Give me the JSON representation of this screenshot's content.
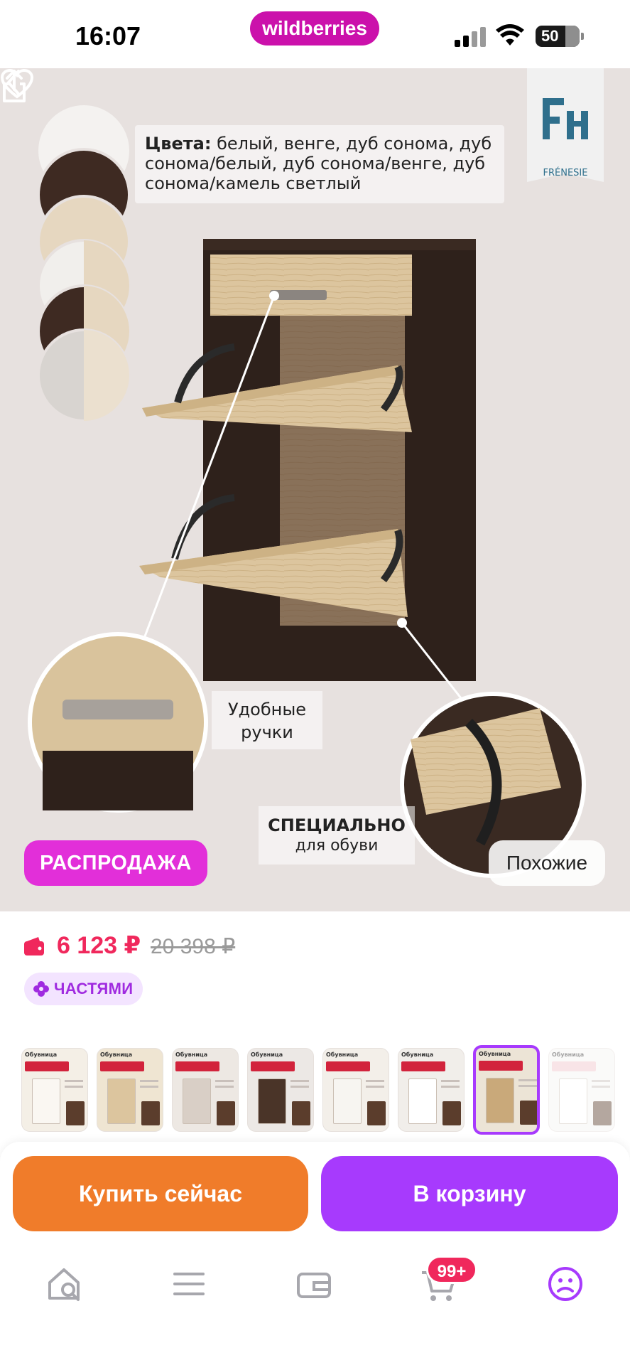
{
  "status_bar": {
    "time": "16:07",
    "brand": "wildberries",
    "battery": "50"
  },
  "image": {
    "colors_heading": "Цвета:",
    "colors_text": "белый, венге, дуб сонома, дуб сонома/белый, дуб сонома/венге, дуб сонома/камель светлый",
    "handles_label_line1": "Удобные",
    "handles_label_line2": "ручки",
    "shoes_label_line1": "СПЕЦИАЛЬНО",
    "shoes_label_line2": "для обуви",
    "logo_text": "FRÉNESIE",
    "sale_badge": "РАСПРОДАЖА",
    "similar_button": "Похожие"
  },
  "price": {
    "current": "6 123 ₽",
    "old": "20 398 ₽",
    "installments": "ЧАСТЯМИ"
  },
  "thumbnails": [
    {
      "title": "Обувница",
      "tone": "#f4efe6",
      "door": "#faf7f2"
    },
    {
      "title": "Обувница",
      "tone": "#efe5d2",
      "door": "#dcc59e"
    },
    {
      "title": "Обувница",
      "tone": "#ede8e3",
      "door": "#d9cfc6"
    },
    {
      "title": "Обувница",
      "tone": "#ece8e5",
      "door": "#4a3428"
    },
    {
      "title": "Обувница",
      "tone": "#f3efe9",
      "door": "#f7f5f1"
    },
    {
      "title": "Обувница",
      "tone": "#f1eeea",
      "door": "#ffffff"
    },
    {
      "title": "Обувница",
      "tone": "#ece4d6",
      "door": "#c9a97a",
      "selected": true
    },
    {
      "title": "Обувница",
      "tone": "#f6f4f2",
      "door": "#ffffff",
      "faded": true
    }
  ],
  "actions": {
    "buy_now": "Купить сейчас",
    "add_to_cart": "В корзину"
  },
  "tab_bar": {
    "cart_count": "99+"
  },
  "colors": {
    "brand": "#cb11ab",
    "accent": "#a73afd",
    "price": "#f0285c",
    "buy_now": "#f07c2a",
    "sale": "#e22fd9"
  }
}
